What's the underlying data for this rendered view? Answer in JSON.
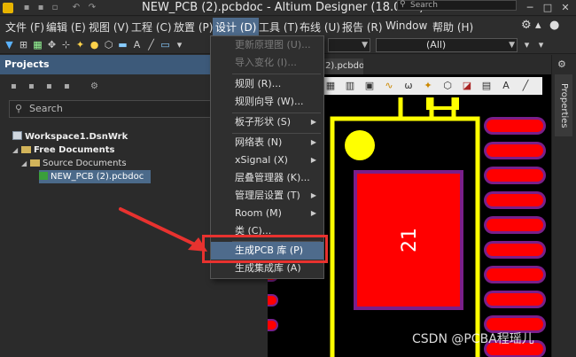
{
  "title_bar": {
    "title": "NEW_PCB (2).pcbdoc - Altium Designer (18.0.12)",
    "search_placeholder": "Search"
  },
  "menu": {
    "items": [
      "文件 (F)",
      "编辑 (E)",
      "视图 (V)",
      "工程 (C)",
      "放置 (P)",
      "设计 (D)",
      "工具 (T)",
      "布线 (U)",
      "报告 (R)",
      "Window",
      "帮助 (H)"
    ],
    "active_index": 5
  },
  "toolbar": {
    "combo_all": "(All)"
  },
  "projects_panel": {
    "title": "Projects",
    "search_placeholder": "Search",
    "tree": [
      {
        "label": "Workspace1.DsnWrk"
      },
      {
        "label": "Free Documents"
      },
      {
        "label": "Source Documents"
      },
      {
        "label": "NEW_PCB (2).pcbdoc"
      }
    ]
  },
  "design_menu": {
    "items": [
      {
        "label": "更新原理图 (U)...",
        "disabled": true
      },
      {
        "label": "导入变化 (I)...",
        "disabled": true
      },
      {
        "label": "规则 (R)..."
      },
      {
        "label": "规则向导 (W)..."
      },
      {
        "label": "板子形状 (S)",
        "submenu": true
      },
      {
        "label": "网络表 (N)",
        "submenu": true
      },
      {
        "label": "xSignal (X)",
        "submenu": true
      },
      {
        "label": "层叠管理器 (K)..."
      },
      {
        "label": "管理层设置 (T)",
        "submenu": true
      },
      {
        "label": "Room (M)",
        "submenu": true
      },
      {
        "label": "类 (C)..."
      },
      {
        "label": "生成PCB 库 (P)",
        "highlighted": true
      },
      {
        "label": "生成集成库 (A)"
      }
    ]
  },
  "document": {
    "tab_label": "2).pcbdoc",
    "pad_designator": "21"
  },
  "properties_label": "Properties",
  "watermark": "CSDN @PCBA程瑶儿",
  "colors": {
    "pad_red": "#ff0000",
    "silk_yellow": "#ffff00",
    "solder_mask": "#7a1f8a",
    "selection_blue": "#4e6b8c",
    "highlight_red": "#e8322f"
  }
}
